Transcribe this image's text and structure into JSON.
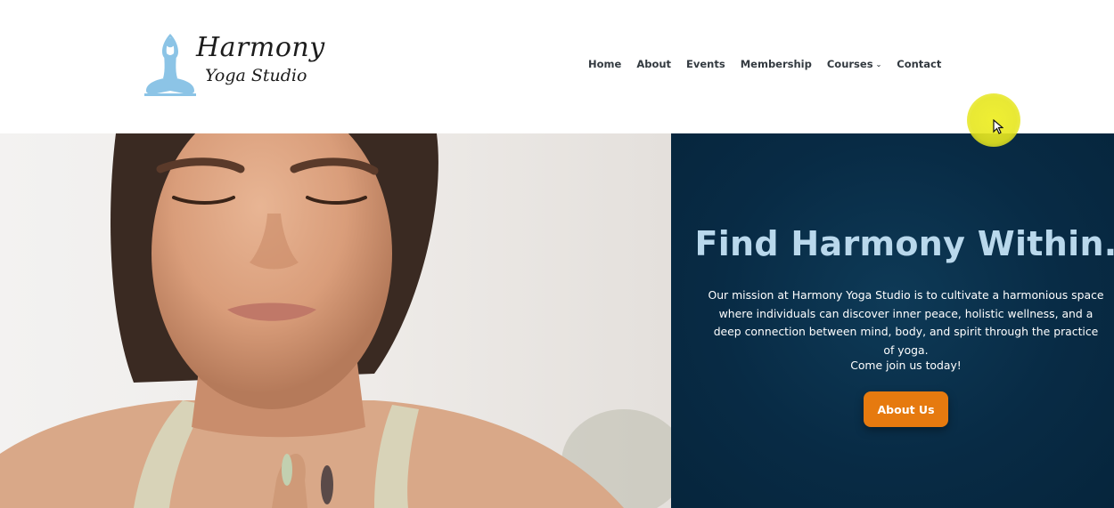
{
  "brand": {
    "line1": "Harmony",
    "line2": "Yoga Studio",
    "icon": "meditating-person-icon",
    "icon_color": "#8cc4e6"
  },
  "nav": {
    "items": [
      {
        "label": "Home"
      },
      {
        "label": "About"
      },
      {
        "label": "Events"
      },
      {
        "label": "Membership"
      },
      {
        "label": "Courses",
        "has_dropdown": true
      },
      {
        "label": "Contact"
      }
    ]
  },
  "hero": {
    "image": "woman-meditating-photo",
    "title": "Find Harmony Within.",
    "mission": "Our mission at Harmony Yoga Studio is to cultivate a harmonious space where individuals can discover inner peace, holistic wellness, and a deep connection between mind, body, and spirit through the practice of yoga.",
    "join_text": "Come join us today!",
    "cta_label": "About Us",
    "panel_color": "#082b45",
    "title_color": "#b9d8ec",
    "cta_color": "#e67a0f"
  },
  "cursor": {
    "icon": "mouse-pointer-icon",
    "highlight_color": "#eeee28"
  }
}
